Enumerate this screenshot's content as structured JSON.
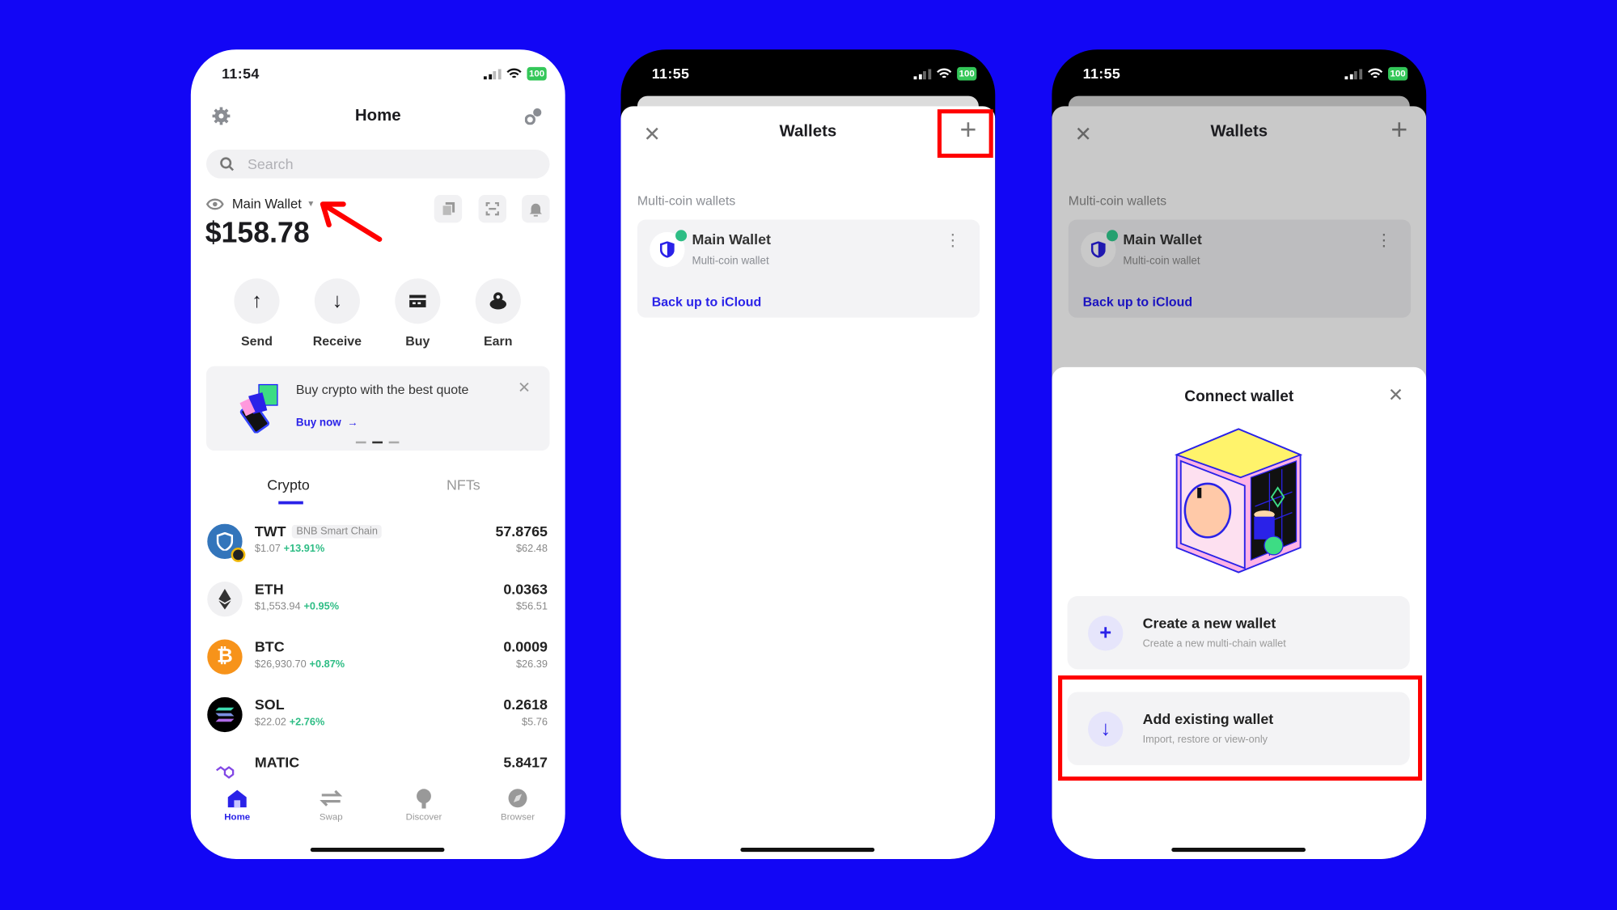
{
  "colors": {
    "background": "#1206f5",
    "accent": "#2a22e8",
    "positive": "#2ebd85",
    "annotation": "#ff0000"
  },
  "home": {
    "status": {
      "time": "11:54",
      "battery": "100"
    },
    "title": "Home",
    "search_placeholder": "Search",
    "wallet_name": "Main Wallet",
    "balance": "$158.78",
    "actions": [
      {
        "label": "Send",
        "icon": "arrow-up"
      },
      {
        "label": "Receive",
        "icon": "arrow-down"
      },
      {
        "label": "Buy",
        "icon": "card"
      },
      {
        "label": "Earn",
        "icon": "piggy"
      }
    ],
    "banner": {
      "text": "Buy crypto with the best quote",
      "link": "Buy now"
    },
    "tabs": [
      "Crypto",
      "NFTs"
    ],
    "assets": [
      {
        "symbol": "TWT",
        "chain": "BNB Smart Chain",
        "price": "$1.07",
        "change": "+13.91%",
        "amount": "57.8765",
        "value": "$62.48",
        "color": "#3375bb"
      },
      {
        "symbol": "ETH",
        "price": "$1,553.94",
        "change": "+0.95%",
        "amount": "0.0363",
        "value": "$56.51",
        "color": "#f0f0f2"
      },
      {
        "symbol": "BTC",
        "price": "$26,930.70",
        "change": "+0.87%",
        "amount": "0.0009",
        "value": "$26.39",
        "color": "#f7931a"
      },
      {
        "symbol": "SOL",
        "price": "$22.02",
        "change": "+2.76%",
        "amount": "0.2618",
        "value": "$5.76",
        "color": "#000000"
      },
      {
        "symbol": "MATIC",
        "amount": "5.8417",
        "color": "#8247e5"
      }
    ],
    "nav": [
      "Home",
      "Swap",
      "Discover",
      "Browser"
    ]
  },
  "wallets": {
    "status": {
      "time": "11:55",
      "battery": "100"
    },
    "title": "Wallets",
    "section": "Multi-coin wallets",
    "wallet_name": "Main Wallet",
    "wallet_type": "Multi-coin wallet",
    "backup": "Back up to iCloud"
  },
  "connect": {
    "status": {
      "time": "11:55",
      "battery": "100"
    },
    "title": "Wallets",
    "section": "Multi-coin wallets",
    "wallet_name": "Main Wallet",
    "wallet_type": "Multi-coin wallet",
    "backup": "Back up to iCloud",
    "sheet_title": "Connect wallet",
    "options": [
      {
        "title": "Create a new wallet",
        "subtitle": "Create a new multi-chain wallet"
      },
      {
        "title": "Add existing wallet",
        "subtitle": "Import, restore or view-only"
      }
    ]
  }
}
